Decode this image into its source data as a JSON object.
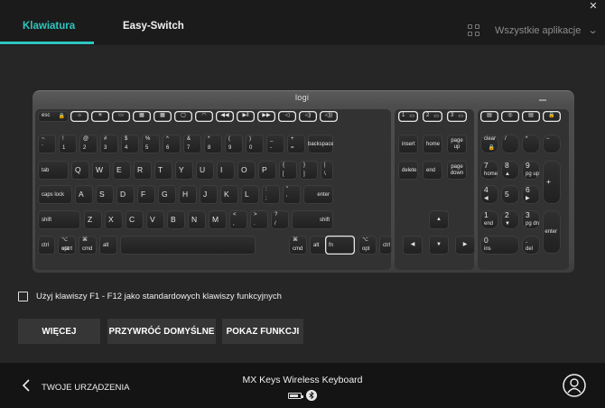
{
  "window": {
    "close_glyph": "✕"
  },
  "tabs": [
    {
      "label": "Klawiatura",
      "active": true
    },
    {
      "label": "Easy-Switch",
      "active": false
    }
  ],
  "apps_selector": {
    "label": "Wszystkie aplikacje",
    "icon": "grid-icon"
  },
  "keyboard": {
    "brand": "logi",
    "rows": [
      [
        {
          "tl": "esc",
          "icon": "lock"
        },
        {
          "icon": "brightness-down"
        },
        {
          "icon": "brightness-up"
        },
        {
          "icon": "task-view"
        },
        {
          "icon": "backlight-down"
        },
        {
          "icon": "backlight-up"
        },
        {
          "icon": "dictation"
        },
        {
          "icon": "emoji"
        },
        {
          "icon": "previous"
        },
        {
          "icon": "play-pause"
        },
        {
          "icon": "next"
        },
        {
          "icon": "mute"
        },
        {
          "icon": "volume-down"
        },
        {
          "icon": "volume-up"
        },
        {
          "tl": "1",
          "icon": "easy-switch"
        },
        {
          "tl": "2",
          "icon": "easy-switch"
        },
        {
          "tl": "3",
          "icon": "easy-switch"
        },
        {
          "icon": "calculator"
        },
        {
          "icon": "screenshot"
        },
        {
          "icon": "context-menu"
        },
        {
          "icon": "lock"
        }
      ],
      [
        {
          "tl": "~",
          "bl": "`"
        },
        {
          "tl": "!",
          "bl": "1"
        },
        {
          "tl": "@",
          "bl": "2"
        },
        {
          "tl": "#",
          "bl": "3"
        },
        {
          "tl": "$",
          "bl": "4"
        },
        {
          "tl": "%",
          "bl": "5"
        },
        {
          "tl": "^",
          "bl": "6"
        },
        {
          "tl": "&",
          "bl": "7"
        },
        {
          "tl": "*",
          "bl": "8"
        },
        {
          "tl": "(",
          "bl": "9"
        },
        {
          "tl": ")",
          "bl": "0"
        },
        {
          "tl": "_",
          "bl": "-"
        },
        {
          "tl": "+",
          "bl": "="
        },
        {
          "label": "backspace"
        },
        {
          "label": "insert"
        },
        {
          "label": "home"
        },
        {
          "l1": "page",
          "l2": "up"
        },
        {
          "tl": "clear",
          "icon": "lock"
        },
        {
          "tl": "/"
        },
        {
          "tl": "*"
        },
        {
          "tl": "−"
        }
      ],
      [
        {
          "label": "tab"
        },
        {
          "big": "Q"
        },
        {
          "big": "W"
        },
        {
          "big": "E"
        },
        {
          "big": "R"
        },
        {
          "big": "T"
        },
        {
          "big": "Y"
        },
        {
          "big": "U"
        },
        {
          "big": "I"
        },
        {
          "big": "O"
        },
        {
          "big": "P"
        },
        {
          "tl": "{",
          "bl": "["
        },
        {
          "tl": "}",
          "bl": "]"
        },
        {
          "tl": "|",
          "bl": "\\"
        },
        {
          "label": "delete"
        },
        {
          "label": "end"
        },
        {
          "l1": "page",
          "l2": "down"
        },
        {
          "big": "7",
          "sub": "home"
        },
        {
          "big": "8",
          "sub": "▲"
        },
        {
          "big": "9",
          "sub": "pg up"
        },
        {
          "big": "+"
        }
      ],
      [
        {
          "label": "caps lock"
        },
        {
          "big": "A"
        },
        {
          "big": "S"
        },
        {
          "big": "D"
        },
        {
          "big": "F"
        },
        {
          "big": "G"
        },
        {
          "big": "H"
        },
        {
          "big": "J"
        },
        {
          "big": "K"
        },
        {
          "big": "L"
        },
        {
          "tl": ":",
          "bl": ";"
        },
        {
          "tl": "\"",
          "bl": "'"
        },
        {
          "label": "enter"
        },
        {
          "big": "4",
          "sub": "◀"
        },
        {
          "big": "5"
        },
        {
          "big": "6",
          "sub": "▶"
        }
      ],
      [
        {
          "label": "shift"
        },
        {
          "big": "Z"
        },
        {
          "big": "X"
        },
        {
          "big": "C"
        },
        {
          "big": "V"
        },
        {
          "big": "B"
        },
        {
          "big": "N"
        },
        {
          "big": "M"
        },
        {
          "tl": "<",
          "bl": ","
        },
        {
          "tl": ">",
          "bl": "."
        },
        {
          "tl": "?",
          "bl": "/"
        },
        {
          "label": "shift"
        },
        {
          "icon": "arrow-up"
        },
        {
          "big": "1",
          "sub": "end"
        },
        {
          "big": "2",
          "sub": "▼"
        },
        {
          "big": "3",
          "sub": "pg dn"
        },
        {
          "label": "enter"
        }
      ],
      [
        {
          "label": "ctrl"
        },
        {
          "tl": "⌥",
          "bl": "opt",
          "br": "start"
        },
        {
          "tl": "⌘",
          "bl": "cmd"
        },
        {
          "label": "alt"
        },
        {
          "label": ""
        },
        {
          "tl": "⌘",
          "bl": "cmd"
        },
        {
          "label": "alt"
        },
        {
          "label": "fn"
        },
        {
          "tl": "⌥",
          "bl": "opt"
        },
        {
          "label": "ctrl"
        },
        {
          "icon": "arrow-left"
        },
        {
          "icon": "arrow-down"
        },
        {
          "icon": "arrow-right"
        },
        {
          "big": "0",
          "sub": "ins"
        },
        {
          "big": ".",
          "sub": "del"
        }
      ]
    ]
  },
  "fkey_option": {
    "label": "Użyj klawiszy F1 - F12 jako standardowych klawiszy funkcyjnych",
    "checked": false
  },
  "buttons": {
    "more": "WIĘCEJ",
    "restore": "PRZYWRÓĆ DOMYŚLNE",
    "show": "POKAZ FUNKCJI"
  },
  "footer": {
    "back_label": "TWOJE URZĄDZENIA",
    "device_name": "MX Keys Wireless Keyboard",
    "battery_level": 0.8,
    "connection_icon": "bluetooth-icon",
    "account_icon": "account-icon"
  },
  "colors": {
    "accent": "#2ec7c0",
    "background": "#262626",
    "topbar": "#1b1b1b",
    "footer": "#141414",
    "button": "#363636"
  }
}
